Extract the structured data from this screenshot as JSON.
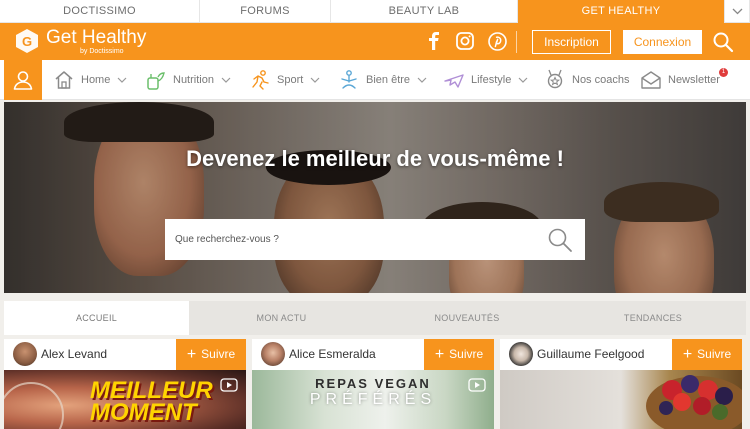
{
  "network": {
    "tabs": [
      "DOCTISSIMO",
      "FORUMS",
      "BEAUTY LAB",
      "GET HEALTHY"
    ],
    "active": "GET HEALTHY"
  },
  "header": {
    "logo_title": "Get Healthy",
    "logo_sub": "by Doctissimo",
    "signup_label": "Inscription",
    "login_label": "Connexion",
    "social_icons": [
      "facebook-icon",
      "instagram-icon",
      "pinterest-icon"
    ]
  },
  "nav": {
    "items": [
      {
        "label": "Home",
        "icon": "home-icon",
        "has_menu": true
      },
      {
        "label": "Nutrition",
        "icon": "nutrition-icon",
        "has_menu": true
      },
      {
        "label": "Sport",
        "icon": "sport-icon",
        "has_menu": true
      },
      {
        "label": "Bien être",
        "icon": "wellbeing-icon",
        "has_menu": true
      },
      {
        "label": "Lifestyle",
        "icon": "plane-icon",
        "has_menu": true
      },
      {
        "label": "Nos coachs",
        "icon": "medal-icon",
        "has_menu": false
      },
      {
        "label": "Newsletter",
        "icon": "mail-icon",
        "has_menu": false,
        "badge": "1"
      }
    ]
  },
  "hero": {
    "title": "Devenez le meilleur de vous-même !",
    "search_placeholder": "Que recherchez-vous ?"
  },
  "tabs": {
    "items": [
      "ACCUEIL",
      "MON ACTU",
      "NOUVEAUTÉS",
      "TENDANCES"
    ],
    "active": "ACCUEIL"
  },
  "coaches": [
    {
      "name": "Alex Levand",
      "follow_label": "Suivre",
      "image_text_1": "MEILLEUR",
      "image_text_2": "MOMENT"
    },
    {
      "name": "Alice Esmeralda",
      "follow_label": "Suivre",
      "image_text_1": "REPAS VEGAN",
      "image_text_2": "PRÉFÉRÉS"
    },
    {
      "name": "Guillaume Feelgood",
      "follow_label": "Suivre"
    }
  ],
  "colors": {
    "brand_orange": "#f7941d",
    "badge_red": "#e03c3c"
  }
}
